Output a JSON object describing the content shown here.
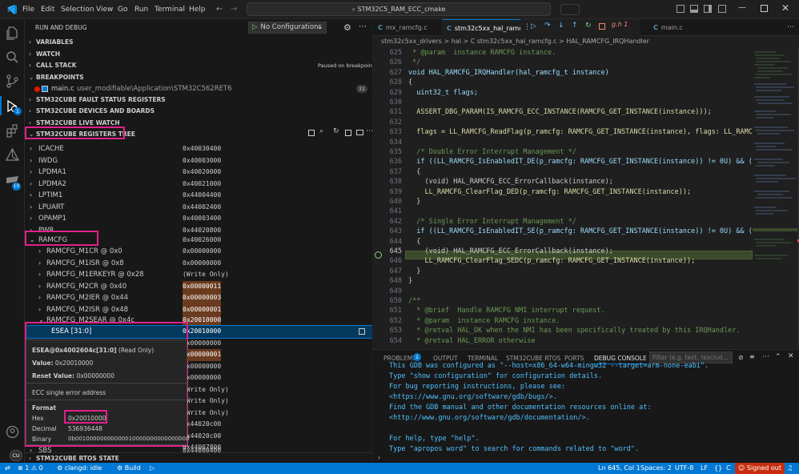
{
  "titlebar": {
    "menus": [
      "File",
      "Edit",
      "Selection",
      "View",
      "Go",
      "Run",
      "Terminal",
      "Help"
    ],
    "search": "STM32C5_RAM_ECC_cmake"
  },
  "activity": {
    "debug_badge": "1",
    "stm32_badge": "10",
    "account_label": "CU"
  },
  "run_debug": {
    "title": "RUN AND DEBUG",
    "config": "No Configurations",
    "sections": {
      "variables": "VARIABLES",
      "watch": "WATCH",
      "call_stack": "CALL STACK",
      "call_stack_status": "Paused on breakpoint",
      "breakpoints": "BREAKPOINTS",
      "fault": "STM32CUBE FAULT STATUS REGISTERS",
      "devices": "STM32CUBE DEVICES AND BOARDS",
      "live_watch": "STM32CUBE LIVE WATCH",
      "registers_tree": "STM32CUBE REGISTERS TREE",
      "rtos_state": "STM32CUBE RTOS STATE"
    },
    "breakpoint": {
      "file": "main.c",
      "path": "user_modifiable\\Application\\STM32C562RET6",
      "line": "31"
    }
  },
  "registers": [
    {
      "name": "ICACHE",
      "value": "0x40030400"
    },
    {
      "name": "IWDG",
      "value": "0x40003000"
    },
    {
      "name": "LPDMA1",
      "value": "0x40020000"
    },
    {
      "name": "LPDMA2",
      "value": "0x40021000"
    },
    {
      "name": "LPTIM1",
      "value": "0x44004400"
    },
    {
      "name": "LPUART",
      "value": "0x44002400"
    },
    {
      "name": "OPAMP1",
      "value": "0x40003400"
    },
    {
      "name": "PWR",
      "value": "0x44020800"
    },
    {
      "name": "RAMCFG",
      "value": "0x40026000"
    },
    {
      "name": "RAMCFG_M1CR @ 0x0",
      "value": "0x00000000"
    },
    {
      "name": "RAMCFG_M1ISR @ 0x8",
      "value": "0x00000000"
    },
    {
      "name": "RAMCFG_M1ERKEYR @ 0x28",
      "value": "(Write Only)"
    },
    {
      "name": "RAMCFG_M2CR @ 0x40",
      "value": "0x00000011"
    },
    {
      "name": "RAMCFG_M2IER @ 0x44",
      "value": "0x00000003"
    },
    {
      "name": "RAMCFG_M2ISR @ 0x48",
      "value": "0x00000001"
    },
    {
      "name": "RAMCFG_M2SEAR @ 0x4c",
      "value": "0x20010000"
    },
    {
      "name": "ESEA [31:0]",
      "value": "0x20010000"
    }
  ],
  "hidden_values": [
    "0x00000000",
    "0x00000000",
    "0x00000001",
    "0x00000000",
    "(Write Only)",
    "(Write Only)",
    "(Write Only)",
    "0x44020c00",
    "0x44020c00",
    "0x44007800",
    "0x44000400"
  ],
  "partial_row": "SBS",
  "tooltip": {
    "title": "ESEA@0x4002604c[31:0]",
    "access": "(Read Only)",
    "value_label": "Value:",
    "value": "0x20010000",
    "reset_label": "Reset Value:",
    "reset": "0x00000000",
    "description": "ECC single error address",
    "format_label": "Format",
    "hex_label": "Hex",
    "hex": "0x20010000",
    "dec_label": "Decimal",
    "dec": "536936448",
    "bin_label": "Binary",
    "bin": "0b00100000000000010000000000000000"
  },
  "editor": {
    "tabs": [
      "mx_ramcfg.c",
      "stm32c5xx_hal_ramcfg.c",
      "g.h 1",
      "main.c"
    ],
    "breadcrumb": "stm32c5xx_drivers  >  hal  >  C  stm32c5xx_hal_ramcfg.c  >  HAL_RAMCFG_IRQHandler",
    "line_numbers": [
      "625",
      "626",
      "627",
      "628",
      "629",
      "630",
      "631",
      "632",
      "633",
      "634",
      "635",
      "636",
      "637",
      "638",
      "639",
      "640",
      "641",
      "642",
      "643",
      "644",
      "645",
      "646",
      "647",
      "648",
      "649",
      "650",
      "651",
      "652",
      "653",
      "654"
    ],
    "lines": [
      " * @param  instance RAMCFG instance.",
      " */",
      "void HAL_RAMCFG_IRQHandler(hal_ramcfg_t instance)",
      "{",
      "  uint32_t flags;",
      "",
      "  ASSERT_DBG_PARAM(IS_RAMCFG_ECC_INSTANCE(RAMCFG_GET_INSTANCE(instance)));",
      "",
      "  flags = LL_RAMCFG_ReadFlag(p_ramcfg: RAMCFG_GET_INSTANCE(instance), flags: LL_RAMCFG",
      "",
      "  /* Double Error Interrupt Management */",
      "  if ((LL_RAMCFG_IsEnabledIT_DE(p_ramcfg: RAMCFG_GET_INSTANCE(instance)) != 0U) && ((f",
      "  {",
      "    (void) HAL_RAMCFG_ECC_ErrorCallback(instance);",
      "    LL_RAMCFG_ClearFlag_DED(p_ramcfg: RAMCFG_GET_INSTANCE(instance));",
      "  }",
      "",
      "  /* Single Error Interrupt Management */",
      "  if ((LL_RAMCFG_IsEnabledIT_SE(p_ramcfg: RAMCFG_GET_INSTANCE(instance)) != 0U) && ((f",
      "  {",
      "    (void) HAL_RAMCFG_ECC_ErrorCallback(instance);",
      "    LL_RAMCFG_ClearFlag_SEDC(p_ramcfg: RAMCFG_GET_INSTANCE(instance));",
      "  }",
      "}",
      "",
      "/**",
      "  * @brief  Handle RAMCFG NMI interrupt request.",
      "  * @param  instance RAMCFG instance.",
      "  * @retval HAL_OK when the NMI has been specifically treated by this IRQHandler.",
      "  * @retval HAL_ERROR otherwise"
    ]
  },
  "panel": {
    "tabs": [
      "PROBLEMS",
      "OUTPUT",
      "TERMINAL",
      "STM32CUBE RTOS",
      "PORTS",
      "DEBUG CONSOLE"
    ],
    "problems_badge": "1",
    "filter_placeholder": "Filter (e.g. text, !exclud...",
    "console": [
      "This GDB was configured as \"--host=x86_64-w64-mingw32 --target=arm-none-eabi\".",
      "Type \"show configuration\" for configuration details.",
      "For bug reporting instructions, please see:",
      "<https://www.gnu.org/software/gdb/bugs/>.",
      "Find the GDB manual and other documentation resources online at:",
      "    <http://www.gnu.org/software/gdb/documentation/>.",
      "",
      "For help, type \"help\".",
      "Type \"apropos word\" to search for commands related to \"word\"."
    ]
  },
  "statusbar": {
    "errors": "1",
    "warnings": "0",
    "clangd": "clangd: idle",
    "build": "Build",
    "position": "Ln 645, Col 1",
    "spaces": "Spaces: 2",
    "encoding": "UTF-8",
    "eol": "LF",
    "language": "C",
    "signed": "Signed out"
  },
  "colors": {
    "accent": "#0078d4",
    "highlight_box": "#e0218a",
    "changed_value": "#6a3b1f"
  }
}
